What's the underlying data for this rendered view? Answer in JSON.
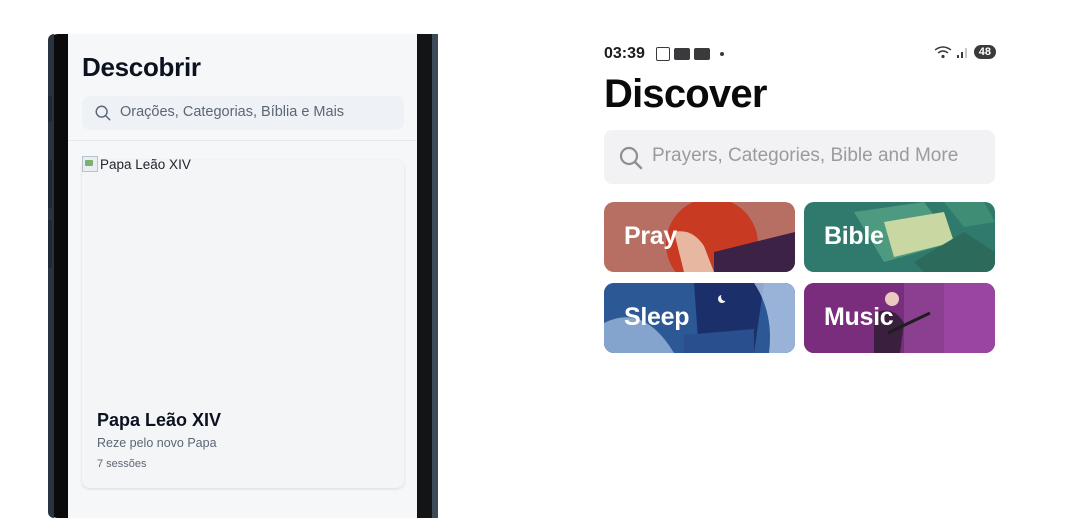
{
  "left_screen": {
    "title": "Descobrir",
    "search_placeholder": "Orações, Categorias, Bíblia e Mais",
    "card": {
      "image_alt": "Papa Leão XIV",
      "title": "Papa Leão XIV",
      "subtitle": "Reze pelo novo Papa",
      "sessions": "7 sessões"
    }
  },
  "right_screen": {
    "status_bar": {
      "time": "03:39",
      "battery": "48"
    },
    "title": "Discover",
    "search_placeholder": "Prayers, Categories, Bible and More",
    "categories": [
      {
        "label": "Pray",
        "color": "#b76f63"
      },
      {
        "label": "Bible",
        "color": "#2f7a6c"
      },
      {
        "label": "Sleep",
        "color": "#2d5896"
      },
      {
        "label": "Music",
        "color": "#7a2d7d"
      }
    ]
  },
  "icons": {
    "search": "magnifier-icon"
  }
}
